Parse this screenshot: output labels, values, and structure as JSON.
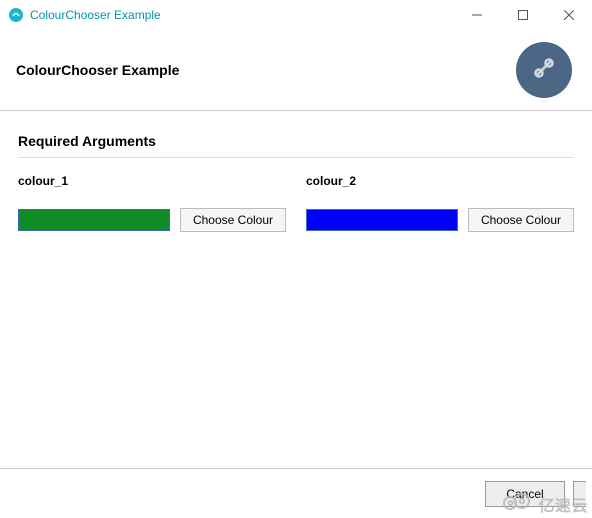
{
  "window": {
    "title": "ColourChooser Example"
  },
  "header": {
    "heading": "ColourChooser Example"
  },
  "section": {
    "title": "Required Arguments"
  },
  "fields": {
    "colour_1": {
      "label": "colour_1",
      "value": "#108c26",
      "button": "Choose Colour"
    },
    "colour_2": {
      "label": "colour_2",
      "value": "#0000ff",
      "button": "Choose Colour"
    }
  },
  "footer": {
    "cancel": "Cancel"
  },
  "watermark": {
    "text": "亿速云"
  },
  "icons": {
    "settings": "settings-wrench"
  },
  "colors": {
    "accent": "#4b6584"
  }
}
